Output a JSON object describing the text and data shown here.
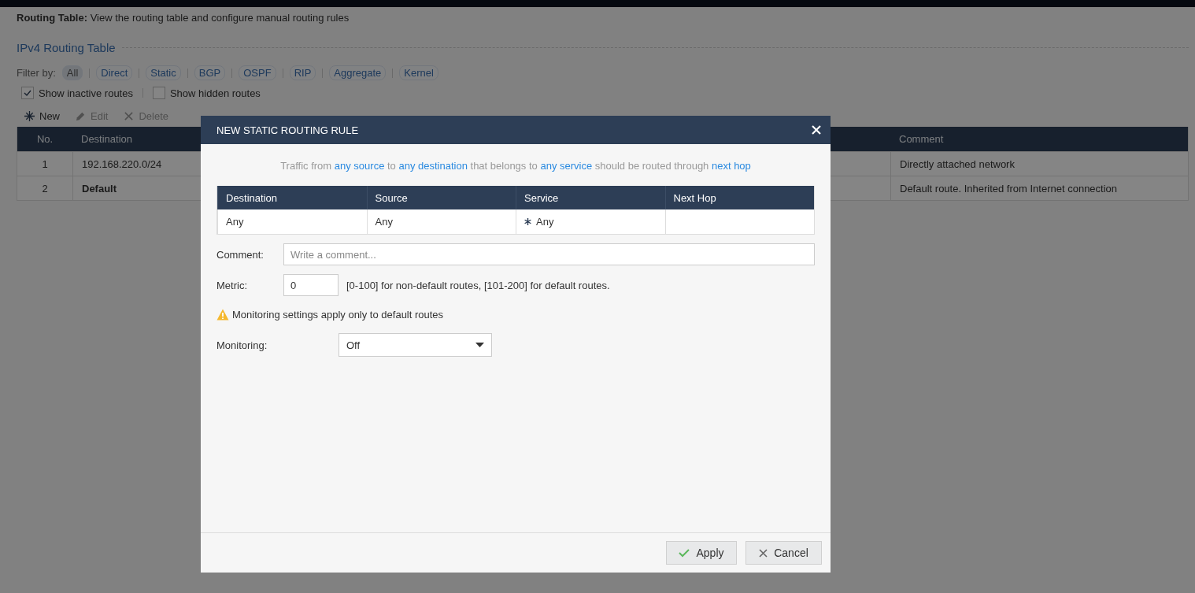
{
  "page": {
    "heading_label": "Routing Table:",
    "heading_text": "View the routing table and configure manual routing rules",
    "section_title": "IPv4 Routing Table",
    "filter_label": "Filter by:",
    "filters": [
      {
        "label": "All",
        "selected": true
      },
      {
        "label": "Direct",
        "selected": false
      },
      {
        "label": "Static",
        "selected": false
      },
      {
        "label": "BGP",
        "selected": false
      },
      {
        "label": "OSPF",
        "selected": false
      },
      {
        "label": "RIP",
        "selected": false
      },
      {
        "label": "Aggregate",
        "selected": false
      },
      {
        "label": "Kernel",
        "selected": false
      }
    ],
    "options": [
      {
        "label": "Show inactive routes",
        "checked": true
      },
      {
        "label": "Show hidden routes",
        "checked": false
      }
    ],
    "toolbar": [
      {
        "label": "New",
        "kind": "new",
        "disabled": false
      },
      {
        "label": "Edit",
        "kind": "edit",
        "disabled": true
      },
      {
        "label": "Delete",
        "kind": "delete",
        "disabled": true
      }
    ],
    "table": {
      "columns": [
        "No.",
        "Destination",
        "Comment"
      ],
      "rows": [
        {
          "no": "1",
          "destination": "192.168.220.0/24",
          "bold": false,
          "comment": "Directly attached network"
        },
        {
          "no": "2",
          "destination": "Default",
          "bold": true,
          "comment": "Default route. Inherited from Internet connection"
        }
      ]
    }
  },
  "dialog": {
    "title": "NEW STATIC ROUTING RULE",
    "summary": [
      {
        "text": "Traffic from ",
        "kind": "plain"
      },
      {
        "text": "any source",
        "kind": "link"
      },
      {
        "text": " to ",
        "kind": "plain"
      },
      {
        "text": "any destination",
        "kind": "link"
      },
      {
        "text": " that belongs to ",
        "kind": "plain"
      },
      {
        "text": "any service",
        "kind": "link"
      },
      {
        "text": " should be routed through ",
        "kind": "plain"
      },
      {
        "text": "next hop",
        "kind": "link"
      }
    ],
    "rule_table": {
      "columns": [
        "Destination",
        "Source",
        "Service",
        "Next Hop"
      ],
      "row": {
        "destination": "Any",
        "source": "Any",
        "service": "Any"
      }
    },
    "comment": {
      "label": "Comment:",
      "placeholder": "Write a comment..."
    },
    "metric": {
      "label": "Metric:",
      "value": "0",
      "hint": "[0-100] for non-default routes, [101-200] for default routes."
    },
    "warning": "Monitoring settings apply only to default routes",
    "monitoring": {
      "label": "Monitoring:",
      "value": "Off"
    },
    "buttons": [
      {
        "label": "Apply",
        "kind": "apply"
      },
      {
        "label": "Cancel",
        "kind": "cancel"
      }
    ]
  }
}
